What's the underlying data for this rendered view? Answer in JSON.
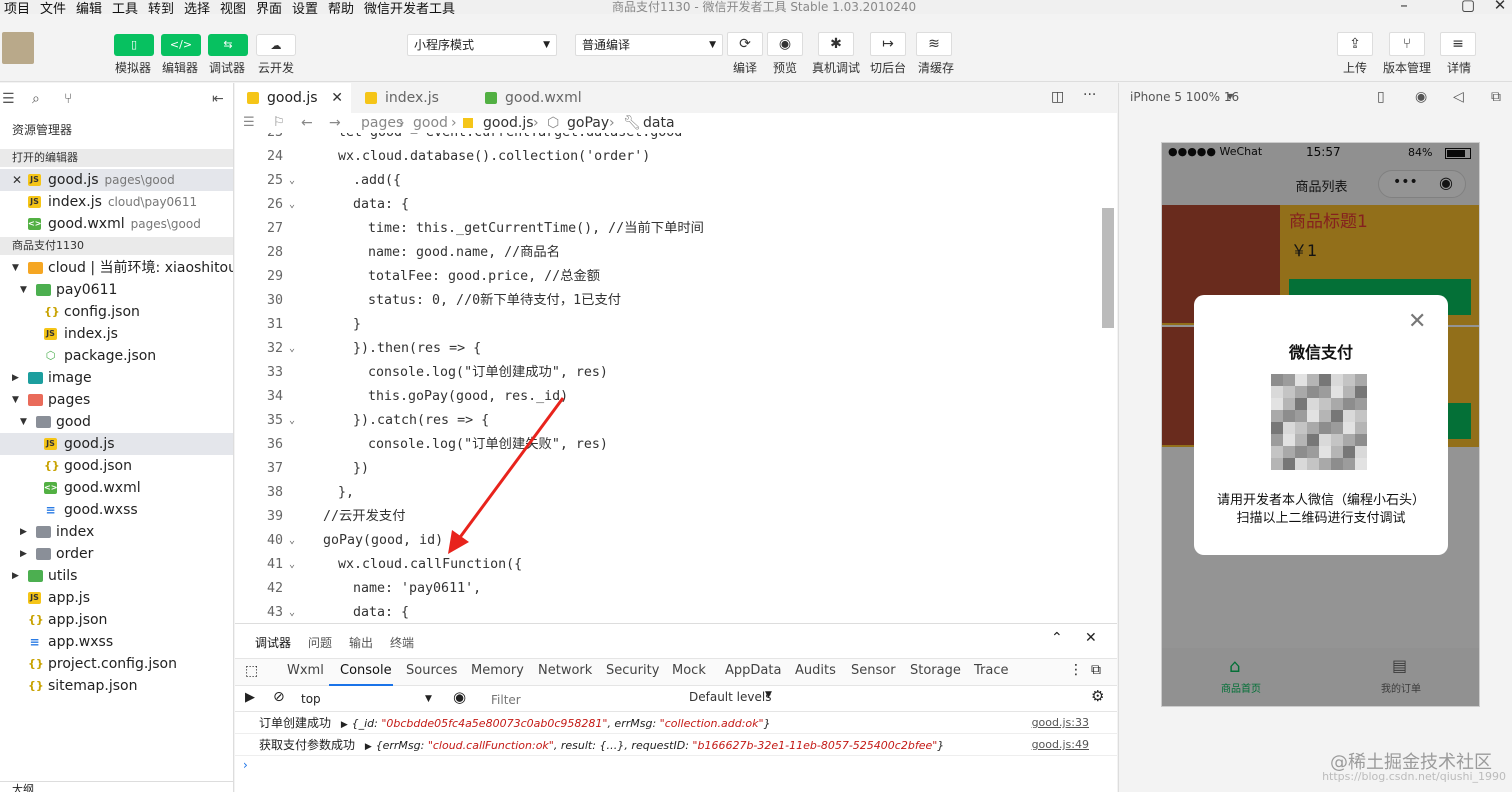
{
  "menu": [
    "项目",
    "文件",
    "编辑",
    "工具",
    "转到",
    "选择",
    "视图",
    "界面",
    "设置",
    "帮助",
    "微信开发者工具"
  ],
  "window_title": "商品支付1130 - 微信开发者工具 Stable 1.03.2010240",
  "toolbar": {
    "simulator": "模拟器",
    "editor": "编辑器",
    "debugger": "调试器",
    "cloud": "云开发",
    "mode_select": "小程序模式",
    "compile_select": "普通编译",
    "compile": "编译",
    "preview": "预览",
    "real_debug": "真机调试",
    "background": "切后台",
    "clear_cache": "清缓存",
    "upload": "上传",
    "version": "版本管理",
    "details": "详情"
  },
  "sidebar": {
    "title": "资源管理器",
    "open_editors": "打开的编辑器",
    "open_files": [
      {
        "name": "good.js",
        "path": "pages\\good"
      },
      {
        "name": "index.js",
        "path": "cloud\\pay0611"
      },
      {
        "name": "good.wxml",
        "path": "pages\\good"
      }
    ],
    "project": "商品支付1130",
    "tree": [
      {
        "label": "cloud | 当前环境: xiaoshitou"
      },
      {
        "label": "pay0611"
      },
      {
        "label": "config.json"
      },
      {
        "label": "index.js"
      },
      {
        "label": "package.json"
      },
      {
        "label": "image"
      },
      {
        "label": "pages"
      },
      {
        "label": "good"
      },
      {
        "label": "good.js"
      },
      {
        "label": "good.json"
      },
      {
        "label": "good.wxml"
      },
      {
        "label": "good.wxss"
      },
      {
        "label": "index"
      },
      {
        "label": "order"
      },
      {
        "label": "utils"
      },
      {
        "label": "app.js"
      },
      {
        "label": "app.json"
      },
      {
        "label": "app.wxss"
      },
      {
        "label": "project.config.json"
      },
      {
        "label": "sitemap.json"
      }
    ],
    "outline": "大纲"
  },
  "tabs": [
    {
      "label": "good.js"
    },
    {
      "label": "index.js"
    },
    {
      "label": "good.wxml"
    }
  ],
  "breadcrumb": [
    "pages",
    "good",
    "good.js",
    "goPay",
    "data"
  ],
  "code_lines": [
    {
      "n": "23",
      "t": "let good = event.currentTarget.dataset.good"
    },
    {
      "n": "24",
      "t": "wx.cloud.database().collection('order')"
    },
    {
      "n": "25",
      "t": ".add({"
    },
    {
      "n": "26",
      "t": "data: {"
    },
    {
      "n": "27",
      "t": "time: this._getCurrentTime(), //当前下单时间"
    },
    {
      "n": "28",
      "t": "name: good.name, //商品名"
    },
    {
      "n": "29",
      "t": "totalFee: good.price, //总金额"
    },
    {
      "n": "30",
      "t": "status: 0, //0新下单待支付，1已支付"
    },
    {
      "n": "31",
      "t": "}"
    },
    {
      "n": "32",
      "t": "}).then(res => {"
    },
    {
      "n": "33",
      "t": "console.log(\"订单创建成功\", res)"
    },
    {
      "n": "34",
      "t": "this.goPay(good, res._id)"
    },
    {
      "n": "35",
      "t": "}).catch(res => {"
    },
    {
      "n": "36",
      "t": "console.log(\"订单创建失败\", res)"
    },
    {
      "n": "37",
      "t": "})"
    },
    {
      "n": "38",
      "t": "},"
    },
    {
      "n": "39",
      "t": "//云开发支付"
    },
    {
      "n": "40",
      "t": "goPay(good, id) {"
    },
    {
      "n": "41",
      "t": "wx.cloud.callFunction({"
    },
    {
      "n": "42",
      "t": "name: 'pay0611',"
    },
    {
      "n": "43",
      "t": "data: {"
    }
  ],
  "debug": {
    "top_tabs": [
      "调试器",
      "问题",
      "输出",
      "终端"
    ],
    "dev_tabs": [
      "Wxml",
      "Console",
      "Sources",
      "Memory",
      "Network",
      "Security",
      "Mock",
      "AppData",
      "Audits",
      "Sensor",
      "Storage",
      "Trace"
    ],
    "context": "top",
    "filter_placeholder": "Filter",
    "levels": "Default levels",
    "logs": [
      {
        "msg": "订单创建成功",
        "obj_prefix": "{_id: ",
        "id": "\"0bcbdde05fc4a5e80073c0ab0c958281\"",
        "mid": ", errMsg: ",
        "err": "\"collection.add:ok\"",
        "suffix": "}",
        "src": "good.js:33"
      },
      {
        "msg": "获取支付参数成功",
        "obj_prefix": "{errMsg: ",
        "id": "\"cloud.callFunction:ok\"",
        "mid": ", result: {…}, requestID: ",
        "err": "\"b166627b-32e1-11eb-8057-525400c2bfee\"",
        "suffix": "}",
        "src": "good.js:49"
      }
    ]
  },
  "simulator": {
    "device": "iPhone 5 100% 16",
    "carrier": "●●●●● WeChat",
    "time": "15:57",
    "battery": "84%",
    "nav_title": "商品列表",
    "product_title": "商品标题1",
    "product_price": "￥1",
    "pay_title": "微信支付",
    "hint1": "请用开发者本人微信（编程小石头）",
    "hint2": "扫描以上二维码进行支付调试",
    "tab_home": "商品首页",
    "tab_orders": "我的订单"
  },
  "watermark": "@稀土掘金技术社区",
  "watermark_url": "https://blog.csdn.net/qiushi_1990"
}
